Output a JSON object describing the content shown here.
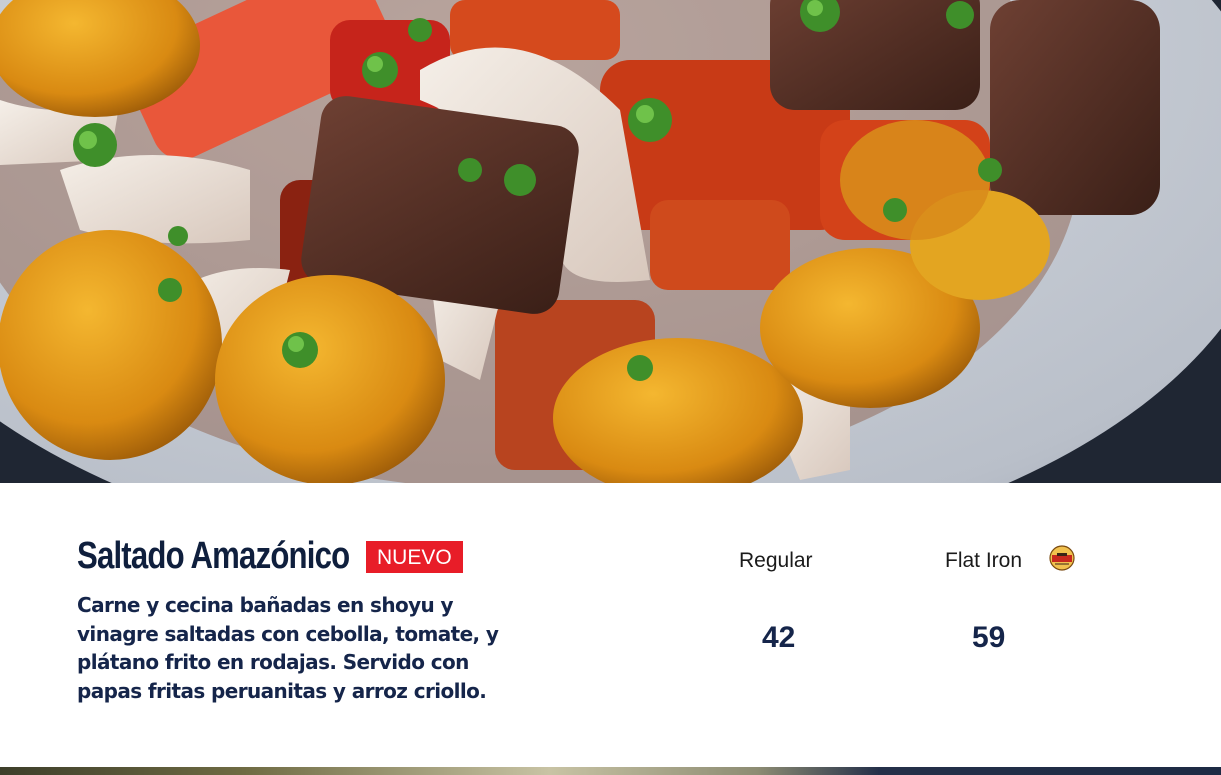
{
  "dish": {
    "name": "Saltado Amazónico",
    "badge": "NUEVO",
    "description": "Carne y cecina bañadas en shoyu y vinagre saltadas con cebolla, tomate, y plátano frito en rodajas. Servido con papas fritas peruanitas y arroz criollo."
  },
  "sizes": [
    {
      "label": "Regular",
      "price": "42"
    },
    {
      "label": "Flat Iron",
      "price": "59",
      "icon": "cow-brand-icon"
    }
  ],
  "colors": {
    "badge": "#e81d28",
    "title": "#0f1f3d",
    "text": "#15254a"
  }
}
